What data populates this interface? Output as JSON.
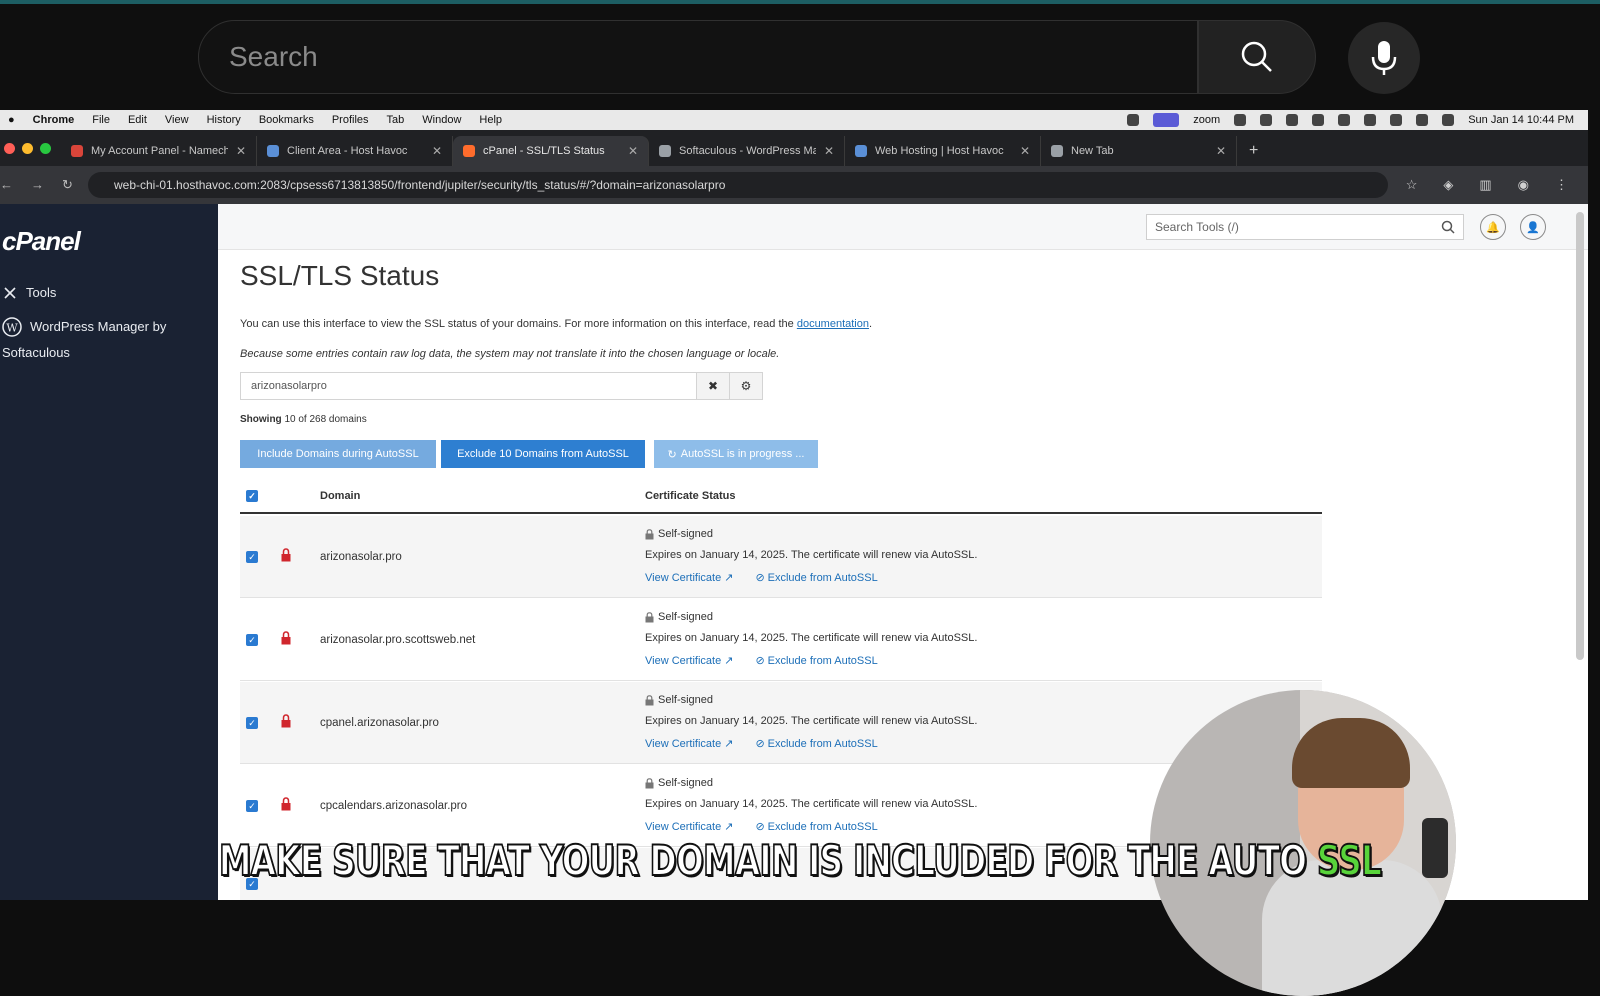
{
  "youtube": {
    "search_placeholder": "Search"
  },
  "macbar": {
    "menus": [
      "Chrome",
      "File",
      "Edit",
      "View",
      "History",
      "Bookmarks",
      "Profiles",
      "Tab",
      "Window",
      "Help"
    ],
    "zoom_label": "zoom",
    "datetime": "Sun Jan 14  10:44 PM"
  },
  "tabs": [
    {
      "title": "My Account Panel - Namechea",
      "color": "#d9453a"
    },
    {
      "title": "Client Area - Host Havoc",
      "color": "#5a8fd6"
    },
    {
      "title": "cPanel - SSL/TLS Status",
      "color": "#ff6c2c"
    },
    {
      "title": "Softaculous - WordPress Mar",
      "color": "#9aa0a6"
    },
    {
      "title": "Web Hosting | Host Havoc",
      "color": "#5a8fd6"
    },
    {
      "title": "New Tab",
      "color": "#9aa0a6"
    }
  ],
  "address": {
    "url": "web-chi-01.hosthavoc.com:2083/cpsess6713813850/frontend/jupiter/security/tls_status/#/?domain=arizonasolarpro"
  },
  "sidebar": {
    "logo": "cPanel",
    "items": [
      {
        "label": "Tools"
      },
      {
        "label": "WordPress Manager by",
        "label2": "Softaculous"
      }
    ]
  },
  "header": {
    "search_placeholder": "Search Tools (/)"
  },
  "page": {
    "title": "SSL/TLS Status",
    "description": "You can use this interface to view the SSL status of your domains. For more information on this interface, read the",
    "doc_link": "documentation",
    "note": "Because some entries contain raw log data, the system may not translate it into the chosen language or locale.",
    "filter_value": "arizonasolarpro",
    "showing_bold": "Showing",
    "showing_rest": "10 of 268 domains",
    "buttons": {
      "include": "Include Domains during AutoSSL",
      "exclude": "Exclude 10 Domains from AutoSSL",
      "progress": "AutoSSL is in progress ..."
    },
    "table": {
      "col_domain": "Domain",
      "col_status": "Certificate Status",
      "rows": [
        {
          "domain": "arizonasolar.pro",
          "status": "Self-signed",
          "expires": "Expires on January 14, 2025. The certificate will renew via AutoSSL.",
          "view": "View Certificate",
          "exclude": "Exclude from AutoSSL"
        },
        {
          "domain": "arizonasolar.pro.scottsweb.net",
          "status": "Self-signed",
          "expires": "Expires on January 14, 2025. The certificate will renew via AutoSSL.",
          "view": "View Certificate",
          "exclude": "Exclude from AutoSSL"
        },
        {
          "domain": "cpanel.arizonasolar.pro",
          "status": "Self-signed",
          "expires": "Expires on January 14, 2025. The certificate will renew via AutoSSL.",
          "view": "View Certificate",
          "exclude": "Exclude from AutoSSL"
        },
        {
          "domain": "cpcalendars.arizonasolar.pro",
          "status": "Self-signed",
          "expires": "Expires on January 14, 2025. The certificate will renew via AutoSSL.",
          "view": "View Certificate",
          "exclude": "Exclude from AutoSSL"
        }
      ]
    }
  },
  "caption": {
    "text": "MAKE SURE THAT YOUR DOMAIN IS INCLUDED FOR THE AUTO",
    "highlight": "SSL"
  },
  "colors": {
    "sidebar_bg": "#1a2233",
    "primary_button": "#2e7fd1",
    "lock_red": "#d0262d",
    "caption_highlight": "#58d43a"
  }
}
